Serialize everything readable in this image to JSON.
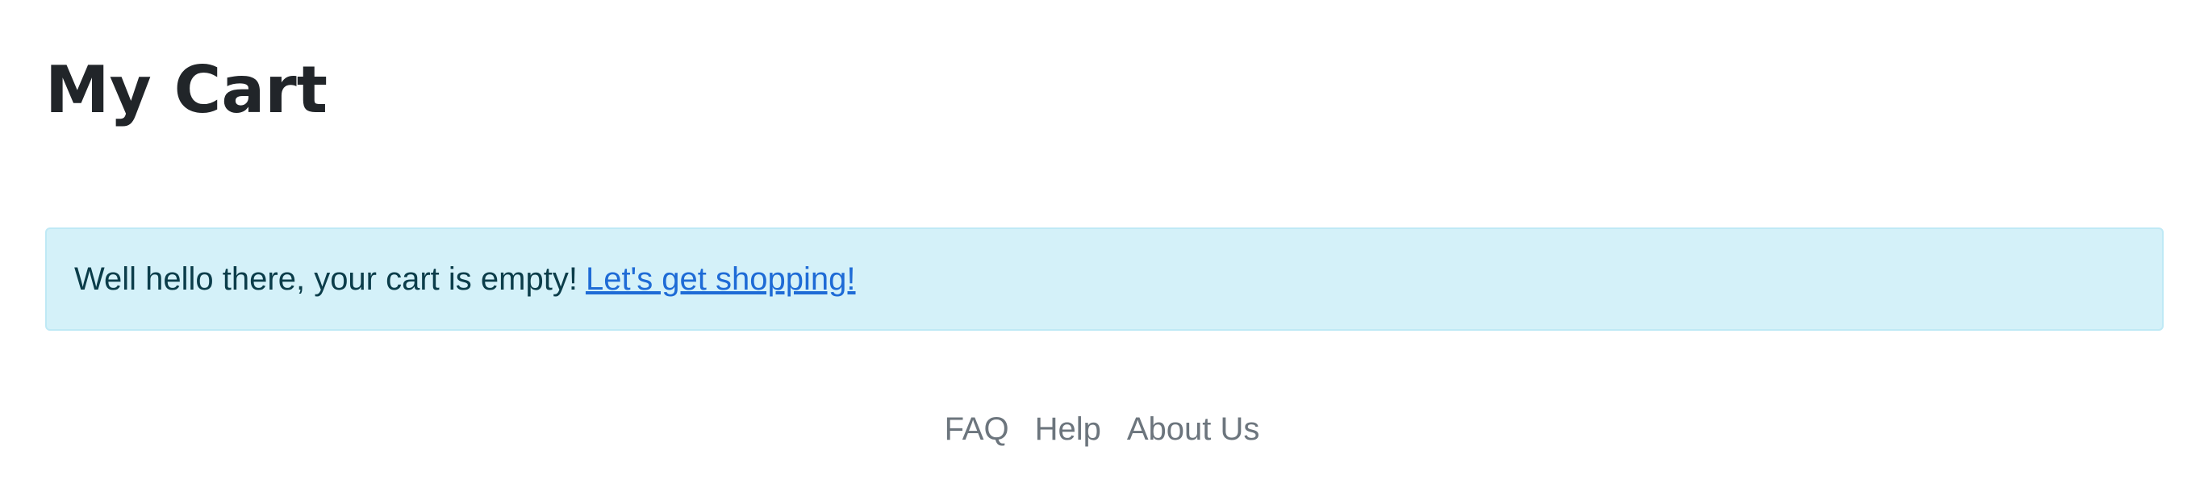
{
  "page": {
    "title": "My Cart"
  },
  "alert": {
    "message": "Well hello there, your cart is empty!",
    "link_label": "Let's get shopping!"
  },
  "footer": {
    "links": [
      {
        "label": "FAQ"
      },
      {
        "label": "Help"
      },
      {
        "label": "About Us"
      }
    ]
  },
  "colors": {
    "alert_background": "#d4f1f9",
    "alert_border": "#bfe9f5",
    "link": "#1e6bd6",
    "title": "#212529",
    "footer_text": "#6c757d"
  }
}
